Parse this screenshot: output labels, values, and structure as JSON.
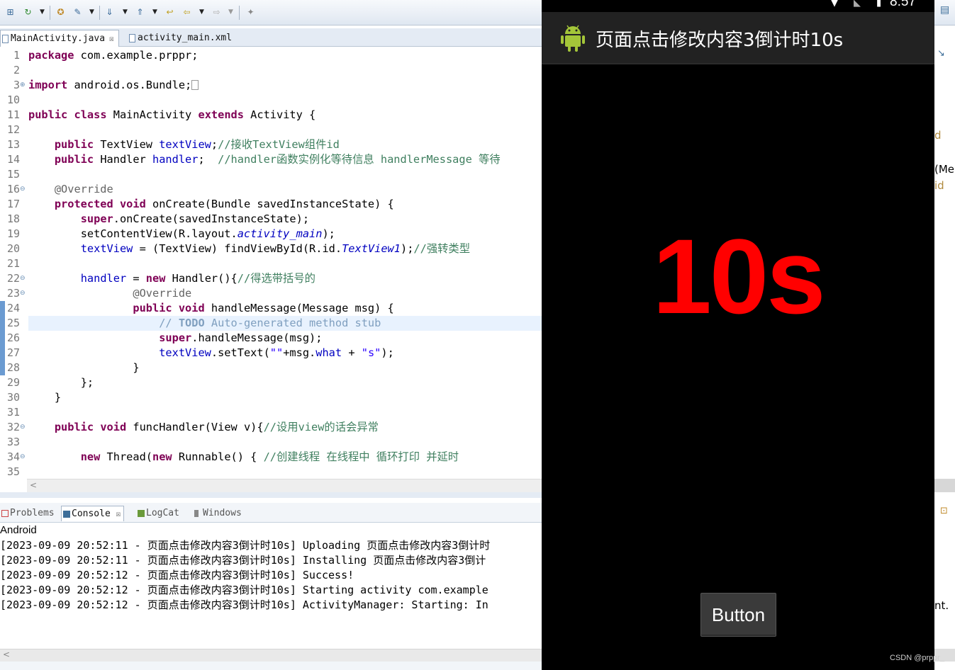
{
  "ide": {
    "toolbar_icons": [
      "new-icon",
      "run-icon",
      "open-perspective-icon",
      "wand-icon",
      "next-annotation-icon",
      "prev-annotation-icon",
      "back-icon",
      "forward-icon",
      "pin-icon"
    ],
    "editor_tabs": [
      {
        "label": "MainActivity.java",
        "close": "☒",
        "active": true
      },
      {
        "label": "activity_main.xml",
        "active": false
      }
    ],
    "code_lines": [
      {
        "n": "1"
      },
      {
        "n": "2"
      },
      {
        "n": "3"
      },
      {
        "n": "10"
      },
      {
        "n": "11"
      },
      {
        "n": "12"
      },
      {
        "n": "13"
      },
      {
        "n": "14"
      },
      {
        "n": "15"
      },
      {
        "n": "16"
      },
      {
        "n": "17"
      },
      {
        "n": "18"
      },
      {
        "n": "19"
      },
      {
        "n": "20"
      },
      {
        "n": "21"
      },
      {
        "n": "22"
      },
      {
        "n": "23"
      },
      {
        "n": "24"
      },
      {
        "n": "25"
      },
      {
        "n": "26"
      },
      {
        "n": "27"
      },
      {
        "n": "28"
      },
      {
        "n": "29"
      },
      {
        "n": "30"
      },
      {
        "n": "31"
      },
      {
        "n": "32"
      },
      {
        "n": "33"
      },
      {
        "n": "34"
      },
      {
        "n": "35"
      }
    ],
    "code": {
      "l1_kw": "package",
      "l1_rest": " com.example.prppr;",
      "l3_kw": "import",
      "l3_rest": " android.os.Bundle;",
      "l11_kw1": "public",
      "l11_kw2": "class",
      "l11_name": " MainActivity ",
      "l11_kw3": "extends",
      "l11_rest": " Activity {",
      "l13_kw": "public",
      "l13_type": " TextView ",
      "l13_field": "textView",
      "l13_semi": ";",
      "l13_comment": "//接收TextView组件id",
      "l14_kw": "public",
      "l14_type": " Handler ",
      "l14_field": "handler",
      "l14_semi": ";  ",
      "l14_comment": "//handler函数实例化等待信息 handlerMessage 等待",
      "l16_ann": "@Override",
      "l17_kw1": "protected",
      "l17_kw2": "void",
      "l17_rest": " onCreate(Bundle savedInstanceState) {",
      "l18_kw": "super",
      "l18_rest": ".onCreate(savedInstanceState);",
      "l19_pre": "setContentView(R.layout.",
      "l19_it": "activity_main",
      "l19_post": ");",
      "l20_field": "textView",
      "l20_mid": " = (TextView) findViewById(R.id.",
      "l20_it": "TextView1",
      "l20_post": ");",
      "l20_comment": "//强转类型",
      "l22_field": "handler",
      "l22_mid": " = ",
      "l22_kw": "new",
      "l22_rest": " Handler(){",
      "l22_comment": "//得选带括号的",
      "l23_ann": "@Override",
      "l24_kw1": "public",
      "l24_kw2": "void",
      "l24_rest": " handleMessage(Message msg) {",
      "l25_slash": "// ",
      "l25_todo": "TODO",
      "l25_rest": " Auto-generated method stub",
      "l26_kw": "super",
      "l26_rest": ".handleMessage(msg);",
      "l27_field": "textView",
      "l27_mid": ".setText(",
      "l27_s1": "\"\"",
      "l27_plus": "+msg.",
      "l27_what": "what",
      "l27_mid2": " + ",
      "l27_s2": "\"s\"",
      "l27_post": ");",
      "l28": "}",
      "l29": "};",
      "l30": "}",
      "l32_kw1": "public",
      "l32_kw2": "void",
      "l32_rest": " funcHandler(View v){",
      "l32_comment": "//设用view的话会异常",
      "l34_kw": "new",
      "l34_mid": " Thread(",
      "l34_kw2": "new",
      "l34_rest": " Runnable() { ",
      "l34_comment": "//创建线程 在线程中 循环打印 并延时"
    },
    "console_tabs": [
      {
        "label": "Problems",
        "active": false
      },
      {
        "label": "Console",
        "close": "☒",
        "active": true
      },
      {
        "label": "LogCat",
        "active": false
      },
      {
        "label": "Windows",
        "active": false
      }
    ],
    "console_label": "Android",
    "console_lines": [
      "[2023-09-09 20:52:11 - 页面点击修改内容3倒计时10s] Uploading 页面点击修改内容3倒计时",
      "[2023-09-09 20:52:11 - 页面点击修改内容3倒计时10s] Installing 页面点击修改内容3倒计",
      "[2023-09-09 20:52:12 - 页面点击修改内容3倒计时10s] Success!",
      "[2023-09-09 20:52:12 - 页面点击修改内容3倒计时10s] Starting activity com.example",
      "[2023-09-09 20:52:12 - 页面点击修改内容3倒计时10s] ActivityManager: Starting: In"
    ],
    "right_fragments": {
      "f1": "d",
      "f2": "(Me",
      "f3": "id",
      "f4": "nt."
    }
  },
  "phone": {
    "status_time": "8:57",
    "app_title": "页面点击修改内容3倒计时10s",
    "countdown_text": "10s",
    "button_label": "Button",
    "countdown_color": "#ff0000"
  },
  "watermark": "CSDN @prppr_"
}
